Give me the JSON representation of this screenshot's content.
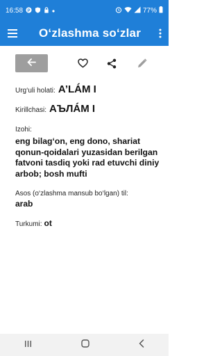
{
  "status": {
    "time": "16:58",
    "battery": "77%"
  },
  "appbar": {
    "title": "O‘zlashma so‘zlar"
  },
  "entry": {
    "original_label": "Urg‘uli holati:",
    "original_value": "A’LÁM I",
    "cyrillic_label": "Kirillchasi:",
    "cyrillic_value": "АЪЛÁМ I",
    "meaning_label": "Izohi:",
    "meaning_value": "eng bilag‘on, eng dono, shariat qonun-qoidalari yuzasidan berilgan fatvoni tasdiq yoki rad etuvchi diniy arbob; bosh mufti",
    "source_label": "Asos (o‘zlashma mansub bo‘lgan) til:",
    "source_value": "arab",
    "group_label": "Turkumi:",
    "group_value": "ot"
  },
  "icons": {
    "menu": "hamburger-menu-icon",
    "more": "more-vertical-icon",
    "back": "arrow-left-icon",
    "favorite": "heart-outline-icon",
    "share": "share-icon",
    "edit": "pencil-icon"
  },
  "colors": {
    "primary": "#1f7fd8",
    "back_button": "#9e9e9e",
    "edit_disabled": "#9e9e9e"
  }
}
